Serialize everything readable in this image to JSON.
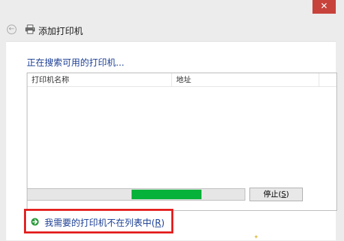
{
  "window": {
    "close_symbol": "✕",
    "title": "添加打印机",
    "back_symbol": "←"
  },
  "search": {
    "status": "正在搜索可用的打印机..."
  },
  "printer_list": {
    "columns": [
      "打印机名称",
      "地址"
    ],
    "rows": []
  },
  "progress": {
    "fill_start": 0.48,
    "fill_end": 0.8,
    "color": "#07b23a"
  },
  "stop_button": {
    "label": "停止",
    "accel_open": "(",
    "accel_key": "S",
    "accel_close": ")"
  },
  "not_listed_link": {
    "text": "我需要的打印机不在列表中",
    "accel_open": "(",
    "accel_key": "R",
    "accel_close": ")"
  },
  "colors": {
    "highlight_border": "#e41f1f",
    "link": "#1c3f94",
    "close_button": "#c8423c"
  },
  "icons": {
    "back": "back-arrow-icon",
    "printer": "printer-icon",
    "link_arrow": "green-arrow-icon",
    "close": "close-icon"
  }
}
